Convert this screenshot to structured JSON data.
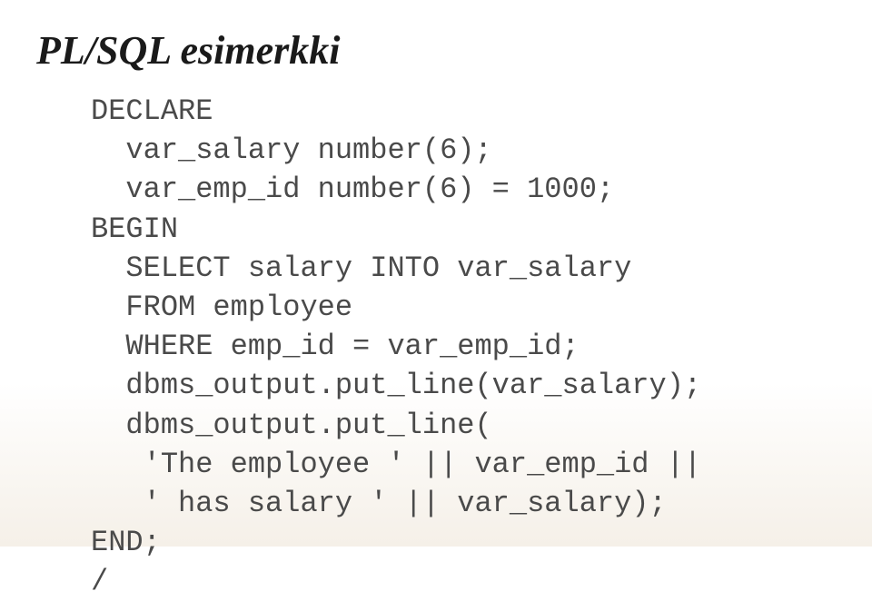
{
  "title": "PL/SQL esimerkki",
  "code": {
    "line1": "DECLARE",
    "line2": "  var_salary number(6);",
    "line3": "  var_emp_id number(6) = 1000;",
    "line4": "BEGIN",
    "line5": "  SELECT salary INTO var_salary",
    "line6": "  FROM employee",
    "line7": "  WHERE emp_id = var_emp_id;",
    "line8": "  dbms_output.put_line(var_salary);",
    "line9": "  dbms_output.put_line(",
    "line10": "   'The employee ' || var_emp_id ||",
    "line11": "   ' has salary ' || var_salary);",
    "line12": "END;",
    "line13": "/"
  }
}
